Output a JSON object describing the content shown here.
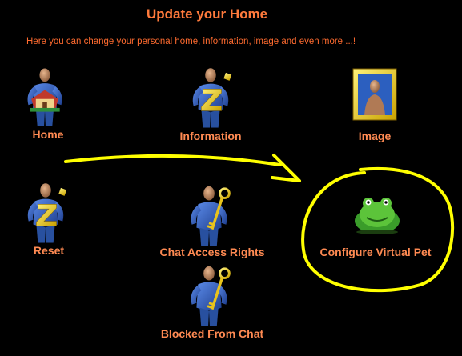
{
  "page": {
    "title": "Update your Home",
    "subtitle": "Here you can change your personal home, information, image and even more ...!"
  },
  "items": {
    "home": {
      "label": "Home",
      "icon": "man-holding-house-icon"
    },
    "information": {
      "label": "Information",
      "icon": "man-with-z-letter-icon"
    },
    "image": {
      "label": "Image",
      "icon": "framed-portrait-icon"
    },
    "reset": {
      "label": "Reset",
      "icon": "man-with-z-letter-icon"
    },
    "chat_access": {
      "label": "Chat Access Rights",
      "icon": "man-holding-key-icon"
    },
    "virtual_pet": {
      "label": "Configure Virtual Pet",
      "icon": "green-frog-pet-icon"
    },
    "blocked_chat": {
      "label": "Blocked From Chat",
      "icon": "man-holding-key-icon"
    }
  },
  "colors": {
    "background": "#000000",
    "title": "#ff7a3c",
    "label": "#ff8a52",
    "annotation": "#ffff00",
    "figure_body": "#3b67c9",
    "figure_head": "#c8946a"
  }
}
